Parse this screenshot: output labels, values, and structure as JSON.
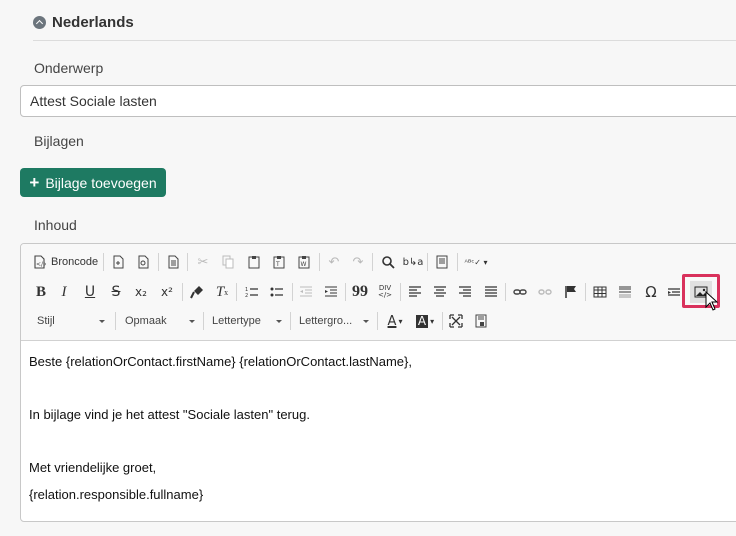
{
  "section": {
    "title": "Nederlands"
  },
  "subject": {
    "label": "Onderwerp",
    "value": "Attest Sociale lasten"
  },
  "attachments": {
    "label": "Bijlagen",
    "add_button": "Bijlage toevoegen"
  },
  "content_label": "Inhoud",
  "toolbar": {
    "source_label": "Broncode",
    "combos": {
      "style": "Stijl",
      "format": "Opmaak",
      "font": "Lettertype",
      "size": "Lettergro..."
    },
    "icons": {
      "bold": "B",
      "italic": "I",
      "underline": "U",
      "strike": "S",
      "subscript": "x₂",
      "superscript": "x²",
      "blockquote": "99",
      "div": "DIV",
      "special_char": "Ω",
      "font_color": "A",
      "bg_color": "A"
    }
  },
  "body_lines": [
    "Beste {relationOrContact.firstName} {relationOrContact.lastName},",
    "In bijlage vind je het attest \"Sociale lasten\" terug.",
    "Met vriendelijke groet,",
    "{relation.responsible.fullname}"
  ],
  "colors": {
    "accent": "#1e7a62",
    "highlight": "#d9315c"
  }
}
